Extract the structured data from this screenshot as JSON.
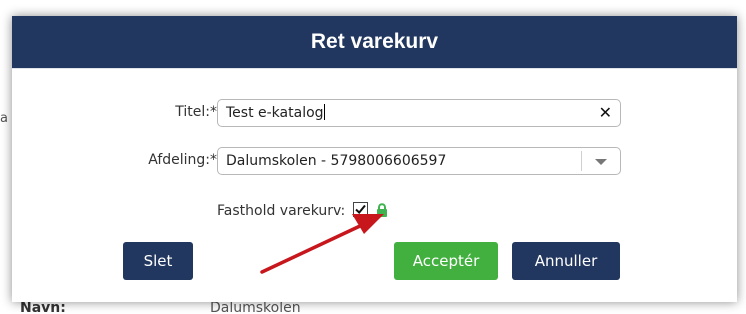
{
  "background": {
    "left_fragment": "a",
    "footer_left": "Navn:",
    "footer_right": "Dalumskolen"
  },
  "dialog": {
    "title": "Ret varekurv",
    "fields": {
      "title_label": "Titel:*",
      "title_value": "Test e-katalog",
      "department_label": "Afdeling:*",
      "department_value": "Dalumskolen - 5798006606597",
      "keep_label": "Fasthold varekurv:",
      "keep_checked": true
    },
    "buttons": {
      "delete": "Slet",
      "accept": "Acceptér",
      "cancel": "Annuller"
    }
  },
  "icons": {
    "clear": "close-icon",
    "dropdown": "chevron-down-icon",
    "lock": "lock-icon",
    "annotation": "red-arrow"
  },
  "colors": {
    "header": "#22375f",
    "primary_button": "#22375f",
    "accept_button": "#42b03f",
    "lock": "#3fb34f",
    "annotation_arrow": "#c8161d"
  }
}
